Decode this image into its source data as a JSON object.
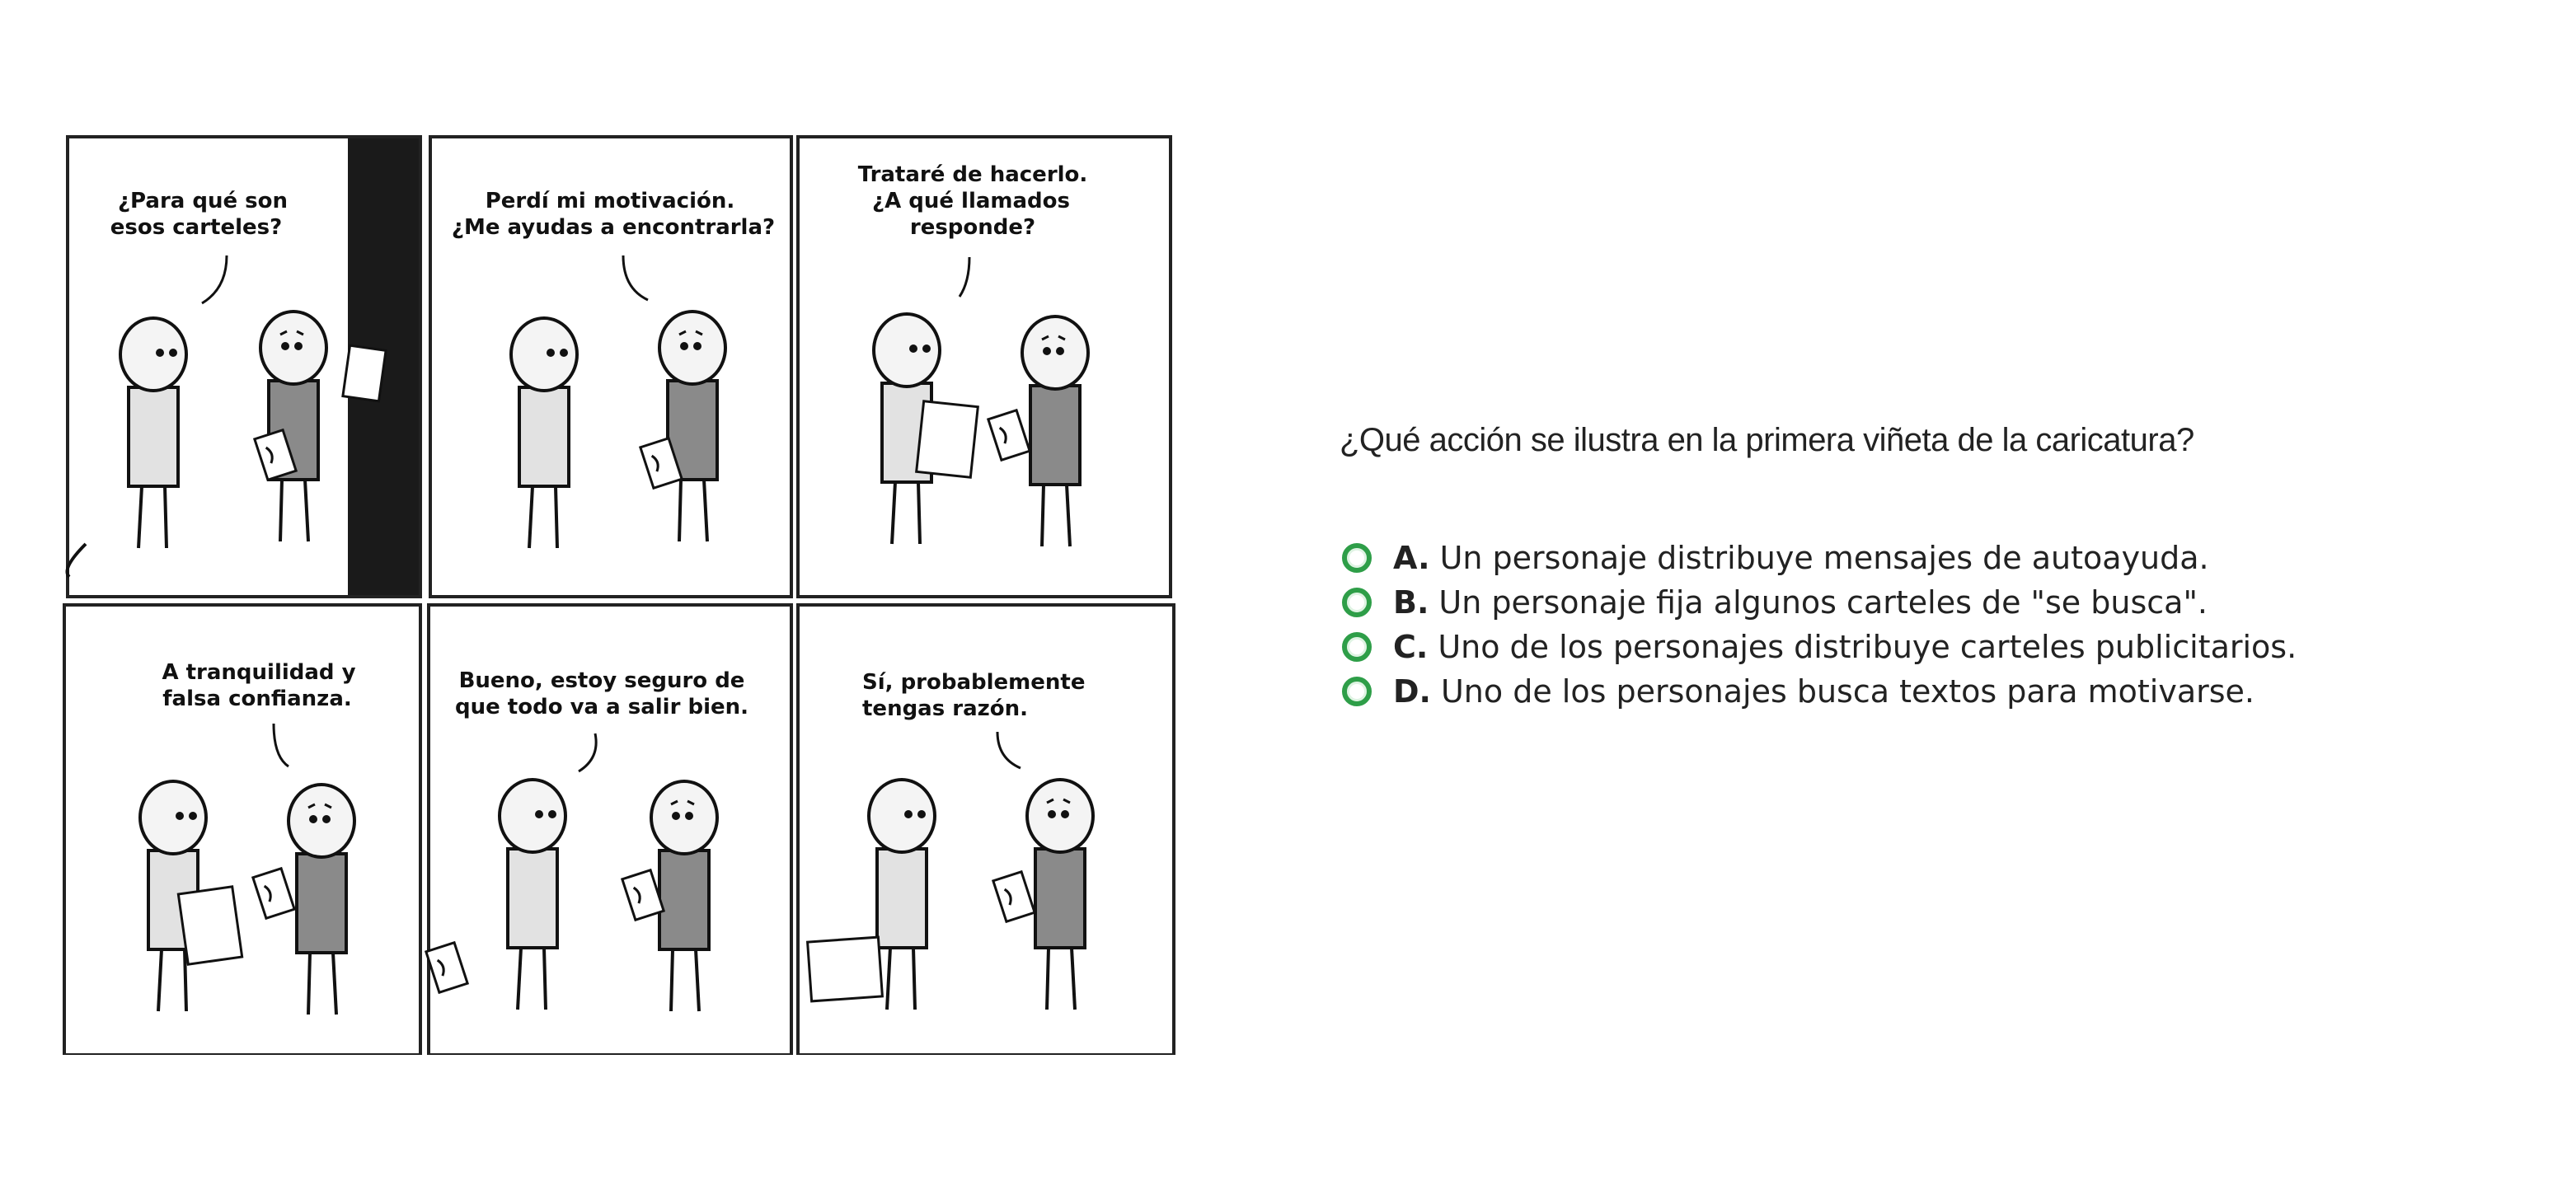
{
  "comic": {
    "panels": [
      {
        "speech": [
          "¿Para qué son",
          "esos carteles?"
        ]
      },
      {
        "speech": [
          "Perdí mi motivación.",
          "¿Me ayudas a encontrarla?"
        ]
      },
      {
        "speech": [
          "Trataré de hacerlo.",
          "¿A qué llamados",
          "responde?"
        ]
      },
      {
        "speech": [
          "A tranquilidad y",
          "falsa confianza."
        ]
      },
      {
        "speech": [
          "Bueno, estoy seguro de",
          "que todo va a salir bien."
        ]
      },
      {
        "speech": [
          "Sí, probablemente",
          "tengas razón."
        ]
      }
    ]
  },
  "question": {
    "text": "¿Qué acción se ilustra en la primera viñeta de la caricatura?",
    "options": [
      {
        "letter": "A.",
        "text": "Un personaje distribuye mensajes de autoayuda."
      },
      {
        "letter": "B.",
        "text": "Un personaje fija algunos carteles de \"se busca\"."
      },
      {
        "letter": "C.",
        "text": "Uno de los personajes distribuye carteles publicitarios."
      },
      {
        "letter": "D.",
        "text": "Uno de los personajes busca textos para motivarse."
      }
    ]
  },
  "colors": {
    "radio": "#2e9e48",
    "light_char": "#e2e2e2",
    "dark_char": "#8a8a8a",
    "pole": "#1a1a1a"
  }
}
